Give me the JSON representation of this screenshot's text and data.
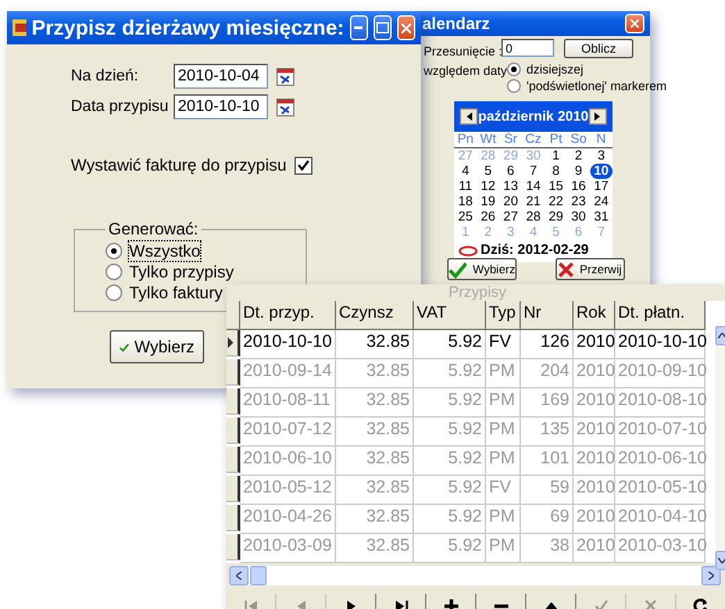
{
  "main_dialog": {
    "title": "Przypisz dzierżawy miesięczne:",
    "fields": [
      {
        "label": "Na dzień:",
        "value": "2010-10-04"
      },
      {
        "label": "Data przypisu",
        "value": "2010-10-10"
      }
    ],
    "invoice_checkbox": {
      "label": "Wystawić fakturę do przypisu",
      "checked": true
    },
    "generate_group": {
      "label": "Generować:",
      "options": [
        {
          "label": "Wszystko",
          "selected": true
        },
        {
          "label": "Tylko przypisy",
          "selected": false
        },
        {
          "label": "Tylko faktury",
          "selected": false
        }
      ]
    },
    "button": "Wybierz"
  },
  "calendar_dialog": {
    "title": "alendarz",
    "offset_label": "Przesunięcie :",
    "offset_value": "0",
    "compute_button": "Oblicz",
    "relative_label": "względem daty",
    "relative_options": [
      {
        "label": "dzisiejszej",
        "selected": true
      },
      {
        "label": "'podświetlonej' markerem",
        "selected": false
      }
    ],
    "month": "październik 2010",
    "weekdays": [
      "Pn",
      "Wt",
      "Śr",
      "Cz",
      "Pt",
      "So",
      "N"
    ],
    "weeks": [
      [
        {
          "day": "27",
          "outside": true,
          "selected": false
        },
        {
          "day": "28",
          "outside": true,
          "selected": false
        },
        {
          "day": "29",
          "outside": true,
          "selected": false
        },
        {
          "day": "30",
          "outside": true,
          "selected": false
        },
        {
          "day": "1",
          "outside": false,
          "selected": false
        },
        {
          "day": "2",
          "outside": false,
          "selected": false
        },
        {
          "day": "3",
          "outside": false,
          "selected": false
        }
      ],
      [
        {
          "day": "4",
          "outside": false,
          "selected": false
        },
        {
          "day": "5",
          "outside": false,
          "selected": false
        },
        {
          "day": "6",
          "outside": false,
          "selected": false
        },
        {
          "day": "7",
          "outside": false,
          "selected": false
        },
        {
          "day": "8",
          "outside": false,
          "selected": false
        },
        {
          "day": "9",
          "outside": false,
          "selected": false
        },
        {
          "day": "10",
          "outside": false,
          "selected": true
        }
      ],
      [
        {
          "day": "11",
          "outside": false,
          "selected": false
        },
        {
          "day": "12",
          "outside": false,
          "selected": false
        },
        {
          "day": "13",
          "outside": false,
          "selected": false
        },
        {
          "day": "14",
          "outside": false,
          "selected": false
        },
        {
          "day": "15",
          "outside": false,
          "selected": false
        },
        {
          "day": "16",
          "outside": false,
          "selected": false
        },
        {
          "day": "17",
          "outside": false,
          "selected": false
        }
      ],
      [
        {
          "day": "18",
          "outside": false,
          "selected": false
        },
        {
          "day": "19",
          "outside": false,
          "selected": false
        },
        {
          "day": "20",
          "outside": false,
          "selected": false
        },
        {
          "day": "21",
          "outside": false,
          "selected": false
        },
        {
          "day": "22",
          "outside": false,
          "selected": false
        },
        {
          "day": "23",
          "outside": false,
          "selected": false
        },
        {
          "day": "24",
          "outside": false,
          "selected": false
        }
      ],
      [
        {
          "day": "25",
          "outside": false,
          "selected": false
        },
        {
          "day": "26",
          "outside": false,
          "selected": false
        },
        {
          "day": "27",
          "outside": false,
          "selected": false
        },
        {
          "day": "28",
          "outside": false,
          "selected": false
        },
        {
          "day": "29",
          "outside": false,
          "selected": false
        },
        {
          "day": "30",
          "outside": false,
          "selected": false
        },
        {
          "day": "31",
          "outside": false,
          "selected": false
        }
      ],
      [
        {
          "day": "1",
          "outside": true,
          "selected": false
        },
        {
          "day": "2",
          "outside": true,
          "selected": false
        },
        {
          "day": "3",
          "outside": true,
          "selected": false
        },
        {
          "day": "4",
          "outside": true,
          "selected": false
        },
        {
          "day": "5",
          "outside": true,
          "selected": false
        },
        {
          "day": "6",
          "outside": true,
          "selected": false
        },
        {
          "day": "7",
          "outside": true,
          "selected": false
        }
      ]
    ],
    "today": "Dziś: 2012-02-29",
    "buttons": [
      {
        "label": "Wybierz",
        "kind": "ok"
      },
      {
        "label": "Przerwij",
        "kind": "cancel"
      }
    ]
  },
  "table": {
    "title": "Przypisy",
    "columns": [
      {
        "label": "Dt. przyp.",
        "kind": "text"
      },
      {
        "label": "Czynsz",
        "kind": "number"
      },
      {
        "label": "VAT",
        "kind": "number"
      },
      {
        "label": "Typ",
        "kind": "text"
      },
      {
        "label": "Nr",
        "kind": "number"
      },
      {
        "label": "Rok",
        "kind": "text"
      },
      {
        "label": "Dt. płatn.",
        "kind": "text"
      }
    ],
    "rows": [
      {
        "current": true,
        "cells": [
          "2010-10-10",
          "32.85",
          "5.92",
          "FV",
          "126",
          "2010",
          "2010-10-10"
        ]
      },
      {
        "current": false,
        "cells": [
          "2010-09-14",
          "32.85",
          "5.92",
          "PM",
          "204",
          "2010",
          "2010-09-10"
        ]
      },
      {
        "current": false,
        "cells": [
          "2010-08-11",
          "32.85",
          "5.92",
          "PM",
          "169",
          "2010",
          "2010-08-10"
        ]
      },
      {
        "current": false,
        "cells": [
          "2010-07-12",
          "32.85",
          "5.92",
          "PM",
          "135",
          "2010",
          "2010-07-10"
        ]
      },
      {
        "current": false,
        "cells": [
          "2010-06-10",
          "32.85",
          "5.92",
          "PM",
          "101",
          "2010",
          "2010-06-10"
        ]
      },
      {
        "current": false,
        "cells": [
          "2010-05-12",
          "32.85",
          "5.92",
          "FV",
          "59",
          "2010",
          "2010-05-10"
        ]
      },
      {
        "current": false,
        "cells": [
          "2010-04-26",
          "32.85",
          "5.92",
          "PM",
          "69",
          "2010",
          "2010-04-10"
        ]
      },
      {
        "current": false,
        "cells": [
          "2010-03-09",
          "32.85",
          "5.92",
          "PM",
          "38",
          "2010",
          "2010-03-10"
        ]
      }
    ],
    "toolbar": [
      {
        "kind": "first",
        "disabled": true
      },
      {
        "kind": "prior",
        "disabled": true
      },
      {
        "kind": "next",
        "disabled": false
      },
      {
        "kind": "last",
        "disabled": false
      },
      {
        "kind": "insert",
        "disabled": false
      },
      {
        "kind": "delete",
        "disabled": false
      },
      {
        "kind": "edit",
        "disabled": false
      },
      {
        "kind": "post",
        "disabled": true
      },
      {
        "kind": "cancel",
        "disabled": true
      },
      {
        "kind": "refresh",
        "disabled": false
      }
    ]
  }
}
